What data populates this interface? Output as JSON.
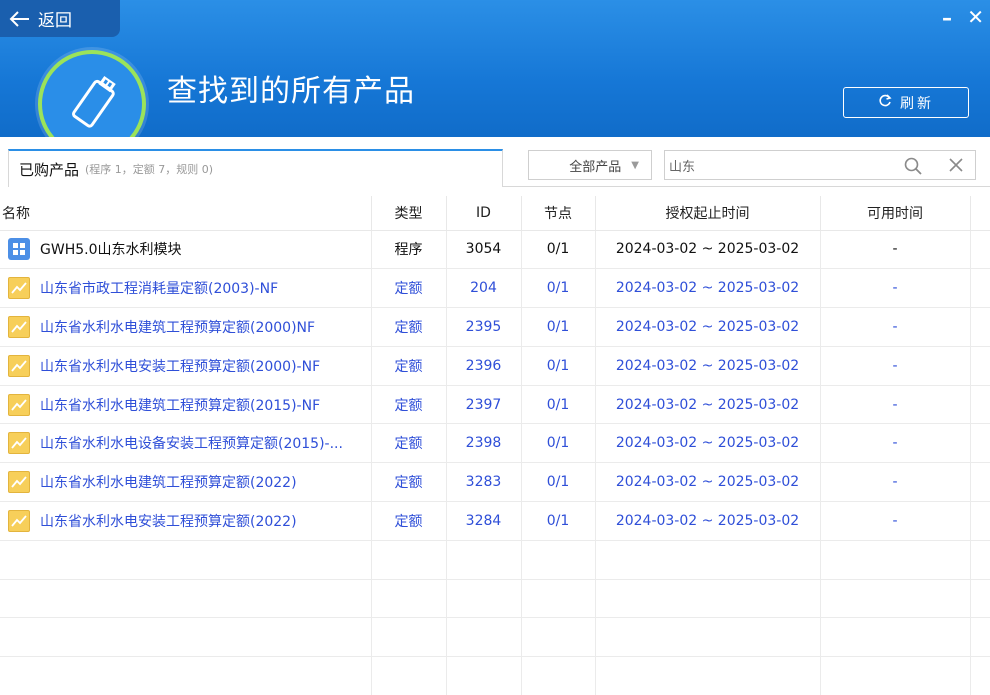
{
  "header": {
    "back_label": "返回",
    "title": "查找到的所有产品",
    "refresh_label": "刷新",
    "minimize_glyph": "–",
    "close_glyph": "✕"
  },
  "toolbar": {
    "tab_label": "已购产品",
    "tab_counts": "(程序 1，定额 7，规则 0)",
    "filter_value": "全部产品",
    "search_value": "山东"
  },
  "table": {
    "columns": [
      "名称",
      "类型",
      "ID",
      "节点",
      "授权起止时间",
      "可用时间"
    ],
    "rows": [
      {
        "kind": "program",
        "icon": "module-grid-icon",
        "name": "GWH5.0山东水利模块",
        "type": "程序",
        "id": "3054",
        "node": "0/1",
        "period": "2024-03-02 ~ 2025-03-02",
        "available": "-"
      },
      {
        "kind": "quota",
        "icon": "chart-trend-icon",
        "name": "山东省市政工程消耗量定额(2003)-NF",
        "type": "定额",
        "id": "204",
        "node": "0/1",
        "period": "2024-03-02 ~ 2025-03-02",
        "available": "-"
      },
      {
        "kind": "quota",
        "icon": "chart-trend-icon",
        "name": "山东省水利水电建筑工程预算定额(2000)NF",
        "type": "定额",
        "id": "2395",
        "node": "0/1",
        "period": "2024-03-02 ~ 2025-03-02",
        "available": "-"
      },
      {
        "kind": "quota",
        "icon": "chart-trend-icon",
        "name": "山东省水利水电安装工程预算定额(2000)-NF",
        "type": "定额",
        "id": "2396",
        "node": "0/1",
        "period": "2024-03-02 ~ 2025-03-02",
        "available": "-"
      },
      {
        "kind": "quota",
        "icon": "chart-trend-icon",
        "name": "山东省水利水电建筑工程预算定额(2015)-NF",
        "type": "定额",
        "id": "2397",
        "node": "0/1",
        "period": "2024-03-02 ~ 2025-03-02",
        "available": "-"
      },
      {
        "kind": "quota",
        "icon": "chart-trend-icon",
        "name": "山东省水利水电设备安装工程预算定额(2015)-...",
        "type": "定额",
        "id": "2398",
        "node": "0/1",
        "period": "2024-03-02 ~ 2025-03-02",
        "available": "-"
      },
      {
        "kind": "quota",
        "icon": "chart-trend-icon",
        "name": "山东省水利水电建筑工程预算定额(2022)",
        "type": "定额",
        "id": "3283",
        "node": "0/1",
        "period": "2024-03-02 ~ 2025-03-02",
        "available": "-"
      },
      {
        "kind": "quota",
        "icon": "chart-trend-icon",
        "name": "山东省水利水电安装工程预算定额(2022)",
        "type": "定额",
        "id": "3284",
        "node": "0/1",
        "period": "2024-03-02 ~ 2025-03-02",
        "available": "-"
      }
    ]
  },
  "colors": {
    "header_blue": "#1677d6",
    "link_blue": "#2f4fd8",
    "logo_ring": "#9be35a",
    "quota_icon": "#f7cf5a",
    "program_icon": "#4c8fe6"
  }
}
